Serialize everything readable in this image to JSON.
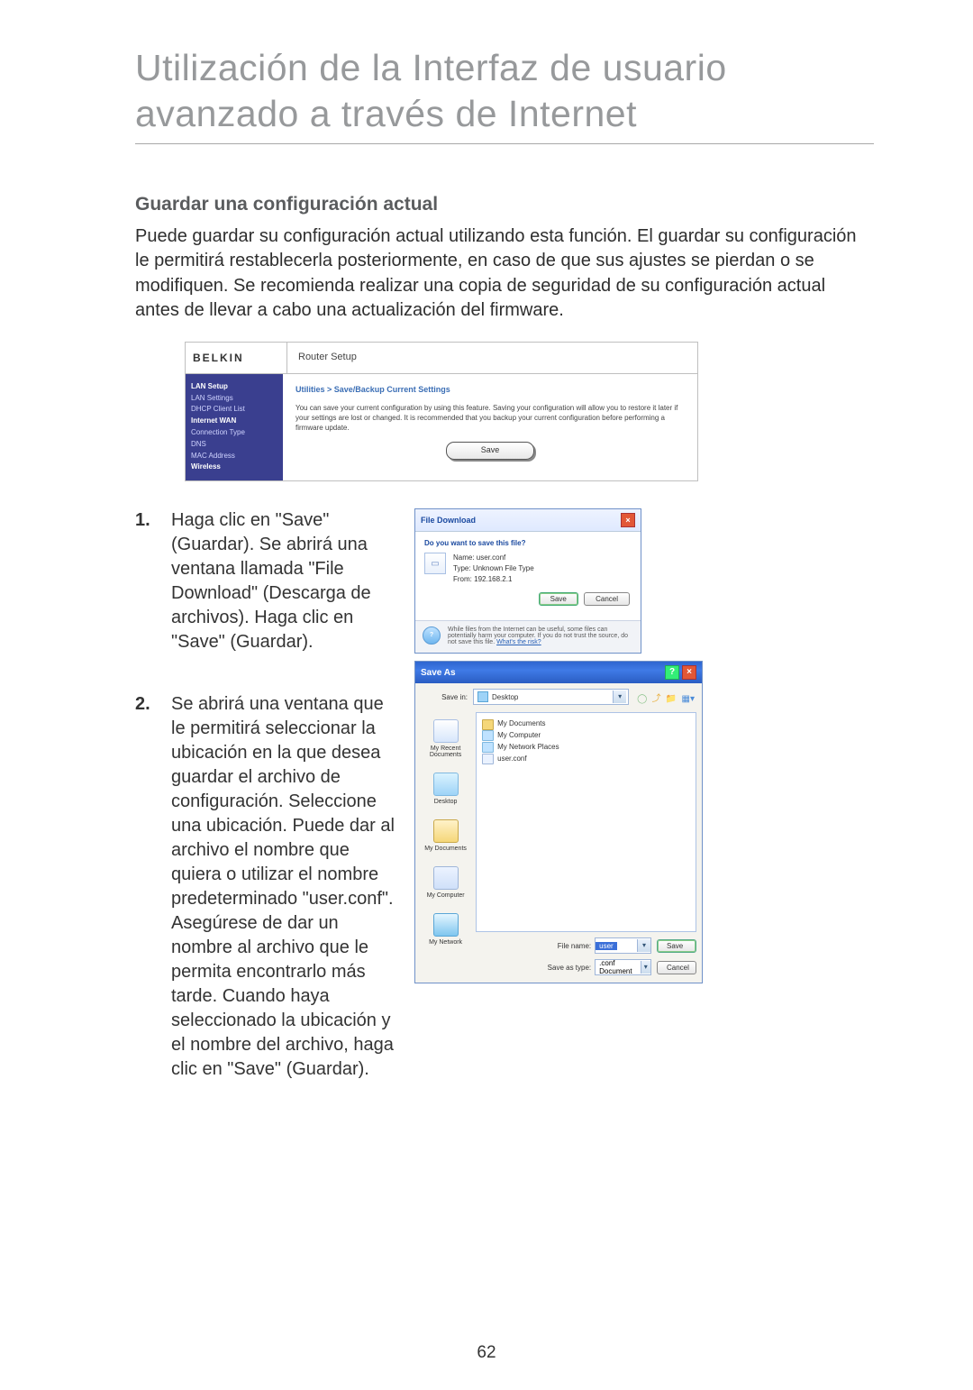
{
  "title": "Utilización de la Interfaz de usuario avanzado a través de Internet",
  "section_title": "Guardar una configuración actual",
  "intro": "Puede guardar su configuración actual utilizando esta función. El guardar su configuración le permitirá restablecerla posteriormente, en caso de que sus ajustes se pierdan o se modifiquen. Se recomienda realizar una copia de seguridad de su configuración actual antes de llevar a cabo una actualización del firmware.",
  "router": {
    "logo": "BELKIN",
    "header_title": "Router Setup",
    "breadcrumb": "Utilities > Save/Backup Current Settings",
    "desc": "You can save your current configuration by using this feature. Saving your configuration will allow you to restore it later if your settings are lost or changed. It is recommended that you backup your current configuration before performing a firmware update.",
    "save_label": "Save",
    "sidebar": {
      "lan_setup": "LAN Setup",
      "lan_settings": "LAN Settings",
      "dhcp": "DHCP Client List",
      "internet_wan": "Internet WAN",
      "conn_type": "Connection Type",
      "dns": "DNS",
      "mac": "MAC Address",
      "wireless": "Wireless"
    }
  },
  "steps": {
    "s1_num": "1.",
    "s1": "Haga clic en \"Save\" (Guardar). Se abrirá una ventana llamada \"File Download\" (Descarga de archivos). Haga clic en \"Save\" (Guardar).",
    "s2_num": "2.",
    "s2": "Se abrirá una ventana que le permitirá seleccionar la ubicación en la que desea guardar el archivo de configuración. Seleccione una ubicación. Puede dar al archivo el nombre que quiera o utilizar el nombre predeterminado \"user.conf\". Asegúrese de dar un nombre al archivo que le permita encontrarlo más tarde. Cuando haya seleccionado la ubicación y el nombre del archivo, haga clic en \"Save\" (Guardar)."
  },
  "download_dialog": {
    "title": "File Download",
    "question": "Do you want to save this file?",
    "name_label": "Name:",
    "name_value": "user.conf",
    "type_label": "Type:",
    "type_value": "Unknown File Type",
    "from_label": "From:",
    "from_value": "192.168.2.1",
    "save": "Save",
    "cancel": "Cancel",
    "footer_text": "While files from the Internet can be useful, some files can potentially harm your computer. If you do not trust the source, do not save this file.",
    "footer_link": "What's the risk?"
  },
  "saveas": {
    "title": "Save As",
    "savein_label": "Save in:",
    "savein_value": "Desktop",
    "places": {
      "recent": "My Recent Documents",
      "desktop": "Desktop",
      "docs": "My Documents",
      "computer": "My Computer",
      "network": "My Network"
    },
    "filelist": {
      "my_documents": "My Documents",
      "my_computer": "My Computer",
      "my_network": "My Network Places",
      "user_conf": "user.conf"
    },
    "file_name_label": "File name:",
    "file_name_value": "user",
    "save_type_label": "Save as type:",
    "save_type_value": ".conf Document",
    "save_btn": "Save",
    "cancel_btn": "Cancel"
  },
  "page_number": "62"
}
